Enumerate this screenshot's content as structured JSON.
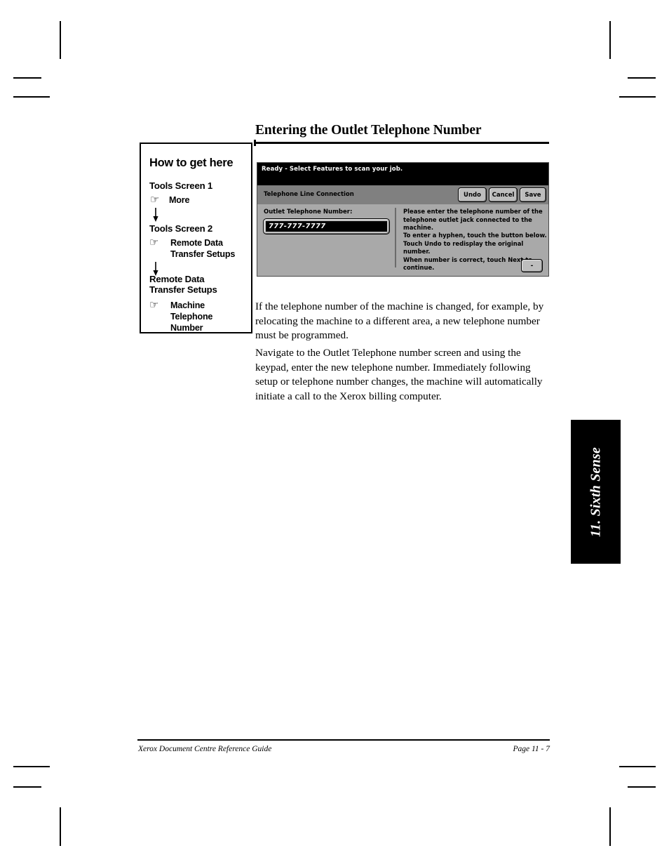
{
  "page": {
    "title": "Entering the Outlet Telephone Number"
  },
  "howto": {
    "heading": "How to get here",
    "steps": [
      {
        "screen": "Tools Screen 1",
        "icon": "pointing-hand-icon",
        "item": "More"
      },
      {
        "screen": "Tools Screen 2",
        "icon": "pointing-hand-icon",
        "item": "Remote Data\nTransfer Setups"
      },
      {
        "screen": "Remote Data\nTransfer Setups",
        "icon": "pointing-hand-icon",
        "item": "Machine\nTelephone\nNumber"
      }
    ]
  },
  "screenshot": {
    "status_text": "Ready -  Select Features to scan your job.",
    "toolbar_title": "Telephone Line Connection",
    "buttons": {
      "undo": "Undo",
      "cancel": "Cancel",
      "save": "Save",
      "hyphen": "-"
    },
    "field_label": "Outlet Telephone Number:",
    "field_value": "777-777-7777",
    "help_1": "Please enter the telephone number of the\ntelephone outlet jack connected to the machine.",
    "help_2": "To enter a hyphen, touch the button below.\nTouch Undo to redisplay the original number.\nWhen number is correct, touch Next to continue.",
    "colors": {
      "status_bar": "#000000",
      "toolbar": "#808080",
      "body": "#a9a9a9",
      "button": "#bdbdbd",
      "field_background": "#000000",
      "field_text": "#ffffff"
    }
  },
  "body": {
    "paragraph_1": "If the telephone number of the machine is changed, for example, by relocating the machine to a different area, a new telephone number must be programmed.",
    "paragraph_2": "Navigate to the Outlet Telephone number screen and using the keypad, enter the new telephone number. Immediately following setup or telephone number changes, the machine will automatically initiate a call to the Xerox billing computer."
  },
  "side_tab": {
    "label": "11. Sixth Sense",
    "color": "#000000"
  },
  "footer": {
    "left": "Xerox Document Centre Reference Guide",
    "right": "Page 11 - 7"
  }
}
